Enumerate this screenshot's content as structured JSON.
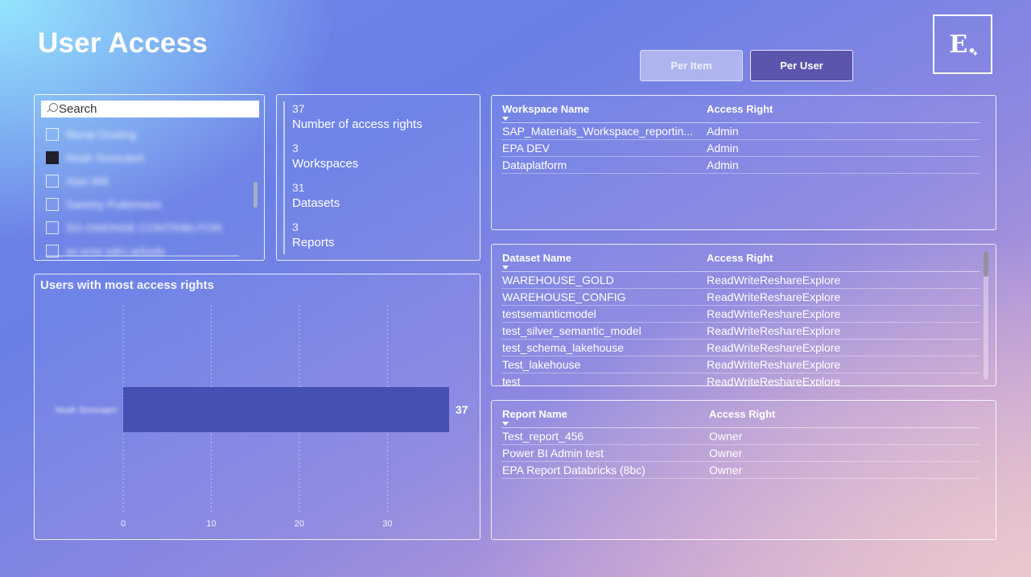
{
  "page": {
    "title": "User Access"
  },
  "logo": {
    "letter": "E.",
    "spark": "✦"
  },
  "buttons": {
    "per_item": "Per Item",
    "per_user": "Per User"
  },
  "slicer": {
    "search_placeholder": "Search",
    "items": [
      {
        "label": "Murat Onsling",
        "checked": false
      },
      {
        "label": "Noah Smovaert",
        "checked": true
      },
      {
        "label": "Alan Mill",
        "checked": false
      },
      {
        "label": "Sammy Puttemans",
        "checked": false
      },
      {
        "label": "SG-DWDNSE-CONTRIBUTOR",
        "checked": false
      },
      {
        "label": "ss-snsr-sdrc-arbsds",
        "checked": false
      }
    ]
  },
  "kpis": [
    {
      "value": "37",
      "label": "Number of access rights"
    },
    {
      "value": "3",
      "label": "Workspaces"
    },
    {
      "value": "31",
      "label": "Datasets"
    },
    {
      "value": "3",
      "label": "Reports"
    }
  ],
  "chart_data": {
    "type": "bar",
    "orientation": "horizontal",
    "title": "Users with most access rights",
    "categories": [
      "Noah Smovaert"
    ],
    "values": [
      37
    ],
    "data_labels": [
      "37"
    ],
    "xlim": [
      0,
      37
    ],
    "xticks": [
      0,
      10,
      20,
      30
    ],
    "grid": "vertical dotted",
    "bar_color": "#4650b4"
  },
  "workspaces": {
    "headers": {
      "name": "Workspace Name",
      "right": "Access Right"
    },
    "rows": [
      {
        "name": "SAP_Materials_Workspace_reportin...",
        "right": "Admin"
      },
      {
        "name": "EPA DEV",
        "right": "Admin"
      },
      {
        "name": "Dataplatform",
        "right": "Admin"
      }
    ]
  },
  "datasets": {
    "headers": {
      "name": "Dataset Name",
      "right": "Access Right"
    },
    "rows": [
      {
        "name": "WAREHOUSE_GOLD",
        "right": "ReadWriteReshareExplore"
      },
      {
        "name": "WAREHOUSE_CONFIG",
        "right": "ReadWriteReshareExplore"
      },
      {
        "name": "testsemanticmodel",
        "right": "ReadWriteReshareExplore"
      },
      {
        "name": "test_silver_semantic_model",
        "right": "ReadWriteReshareExplore"
      },
      {
        "name": "test_schema_lakehouse",
        "right": "ReadWriteReshareExplore"
      },
      {
        "name": "Test_lakehouse",
        "right": "ReadWriteReshareExplore"
      },
      {
        "name": "test",
        "right": "ReadWriteReshareExplore"
      }
    ]
  },
  "reports": {
    "headers": {
      "name": "Report Name",
      "right": "Access Right"
    },
    "rows": [
      {
        "name": "Test_report_456",
        "right": "Owner"
      },
      {
        "name": "Power BI Admin test",
        "right": "Owner"
      },
      {
        "name": "EPA Report Databricks (8bc)",
        "right": "Owner"
      }
    ]
  }
}
